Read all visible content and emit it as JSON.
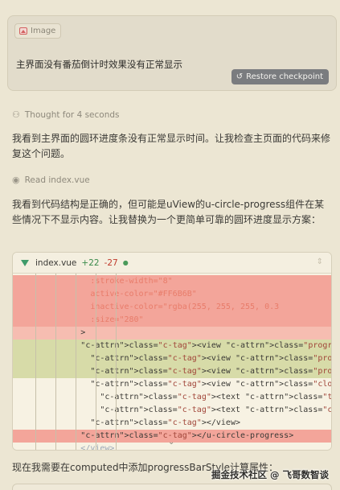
{
  "user_message": {
    "attachment_label": "Image",
    "text": "主界面没有番茄倒计时效果没有正常显示",
    "restore_label": "Restore checkpoint"
  },
  "assistant": {
    "thought_label": "Thought for 4 seconds",
    "para1": "我看到主界面的圆环进度条没有正常显示时间。让我检查主页面的代码来修复这个问题。",
    "read_label": "Read index.vue",
    "para2": "我看到代码结构是正确的，但可能是uView的u-circle-progress组件在某些情况下不显示内容。让我替换为一个更简单可靠的圆环进度显示方案：",
    "para3": "现在我需要在computed中添加progressBarStyle计算属性："
  },
  "diff": {
    "file_name": "index.vue",
    "added": "+22",
    "removed": "-27",
    "lines": [
      {
        "kind": "del",
        "indent": "                ",
        "text": ":stroke-width=\"8\""
      },
      {
        "kind": "del",
        "indent": "                ",
        "text": "active-color=\"#FF6B6B\""
      },
      {
        "kind": "del",
        "indent": "                ",
        "text": "inactive-color=\"rgba(255, 255, 255, 0.3"
      },
      {
        "kind": "del",
        "indent": "                ",
        "text": ":size=\"280\""
      },
      {
        "kind": "del",
        "indent": "              ",
        "text": ">"
      },
      {
        "kind": "add",
        "indent": "              ",
        "text": "<view class=\"progress-circle\">"
      },
      {
        "kind": "add",
        "indent": "                ",
        "text": "<view class=\"progress-track\"></view>"
      },
      {
        "kind": "add",
        "indent": "                ",
        "text": "<view class=\"progress-bar\" :style=\"pr"
      },
      {
        "kind": "neutral",
        "indent": "                ",
        "text": "<view class=\"clock-center\">"
      },
      {
        "kind": "neutral",
        "indent": "                  ",
        "text": "<text class=\"time-display\">{{ form"
      },
      {
        "kind": "neutral",
        "indent": "                  ",
        "text": "<text class=\"cycle-count\">第 {{ cu"
      },
      {
        "kind": "neutral",
        "indent": "                ",
        "text": "</view>"
      },
      {
        "kind": "del",
        "indent": "              ",
        "text": "</u-circle-progress>"
      },
      {
        "kind": "neutral",
        "indent": "              ",
        "text": "</view>"
      }
    ]
  },
  "watermark": "掘金技术社区 @ 飞哥数智谈",
  "colors": {
    "background": "#ece6d3",
    "deleted_line": "#f3a59a",
    "added_line": "#d7dba8",
    "restore_button": "#7a7c7f"
  }
}
